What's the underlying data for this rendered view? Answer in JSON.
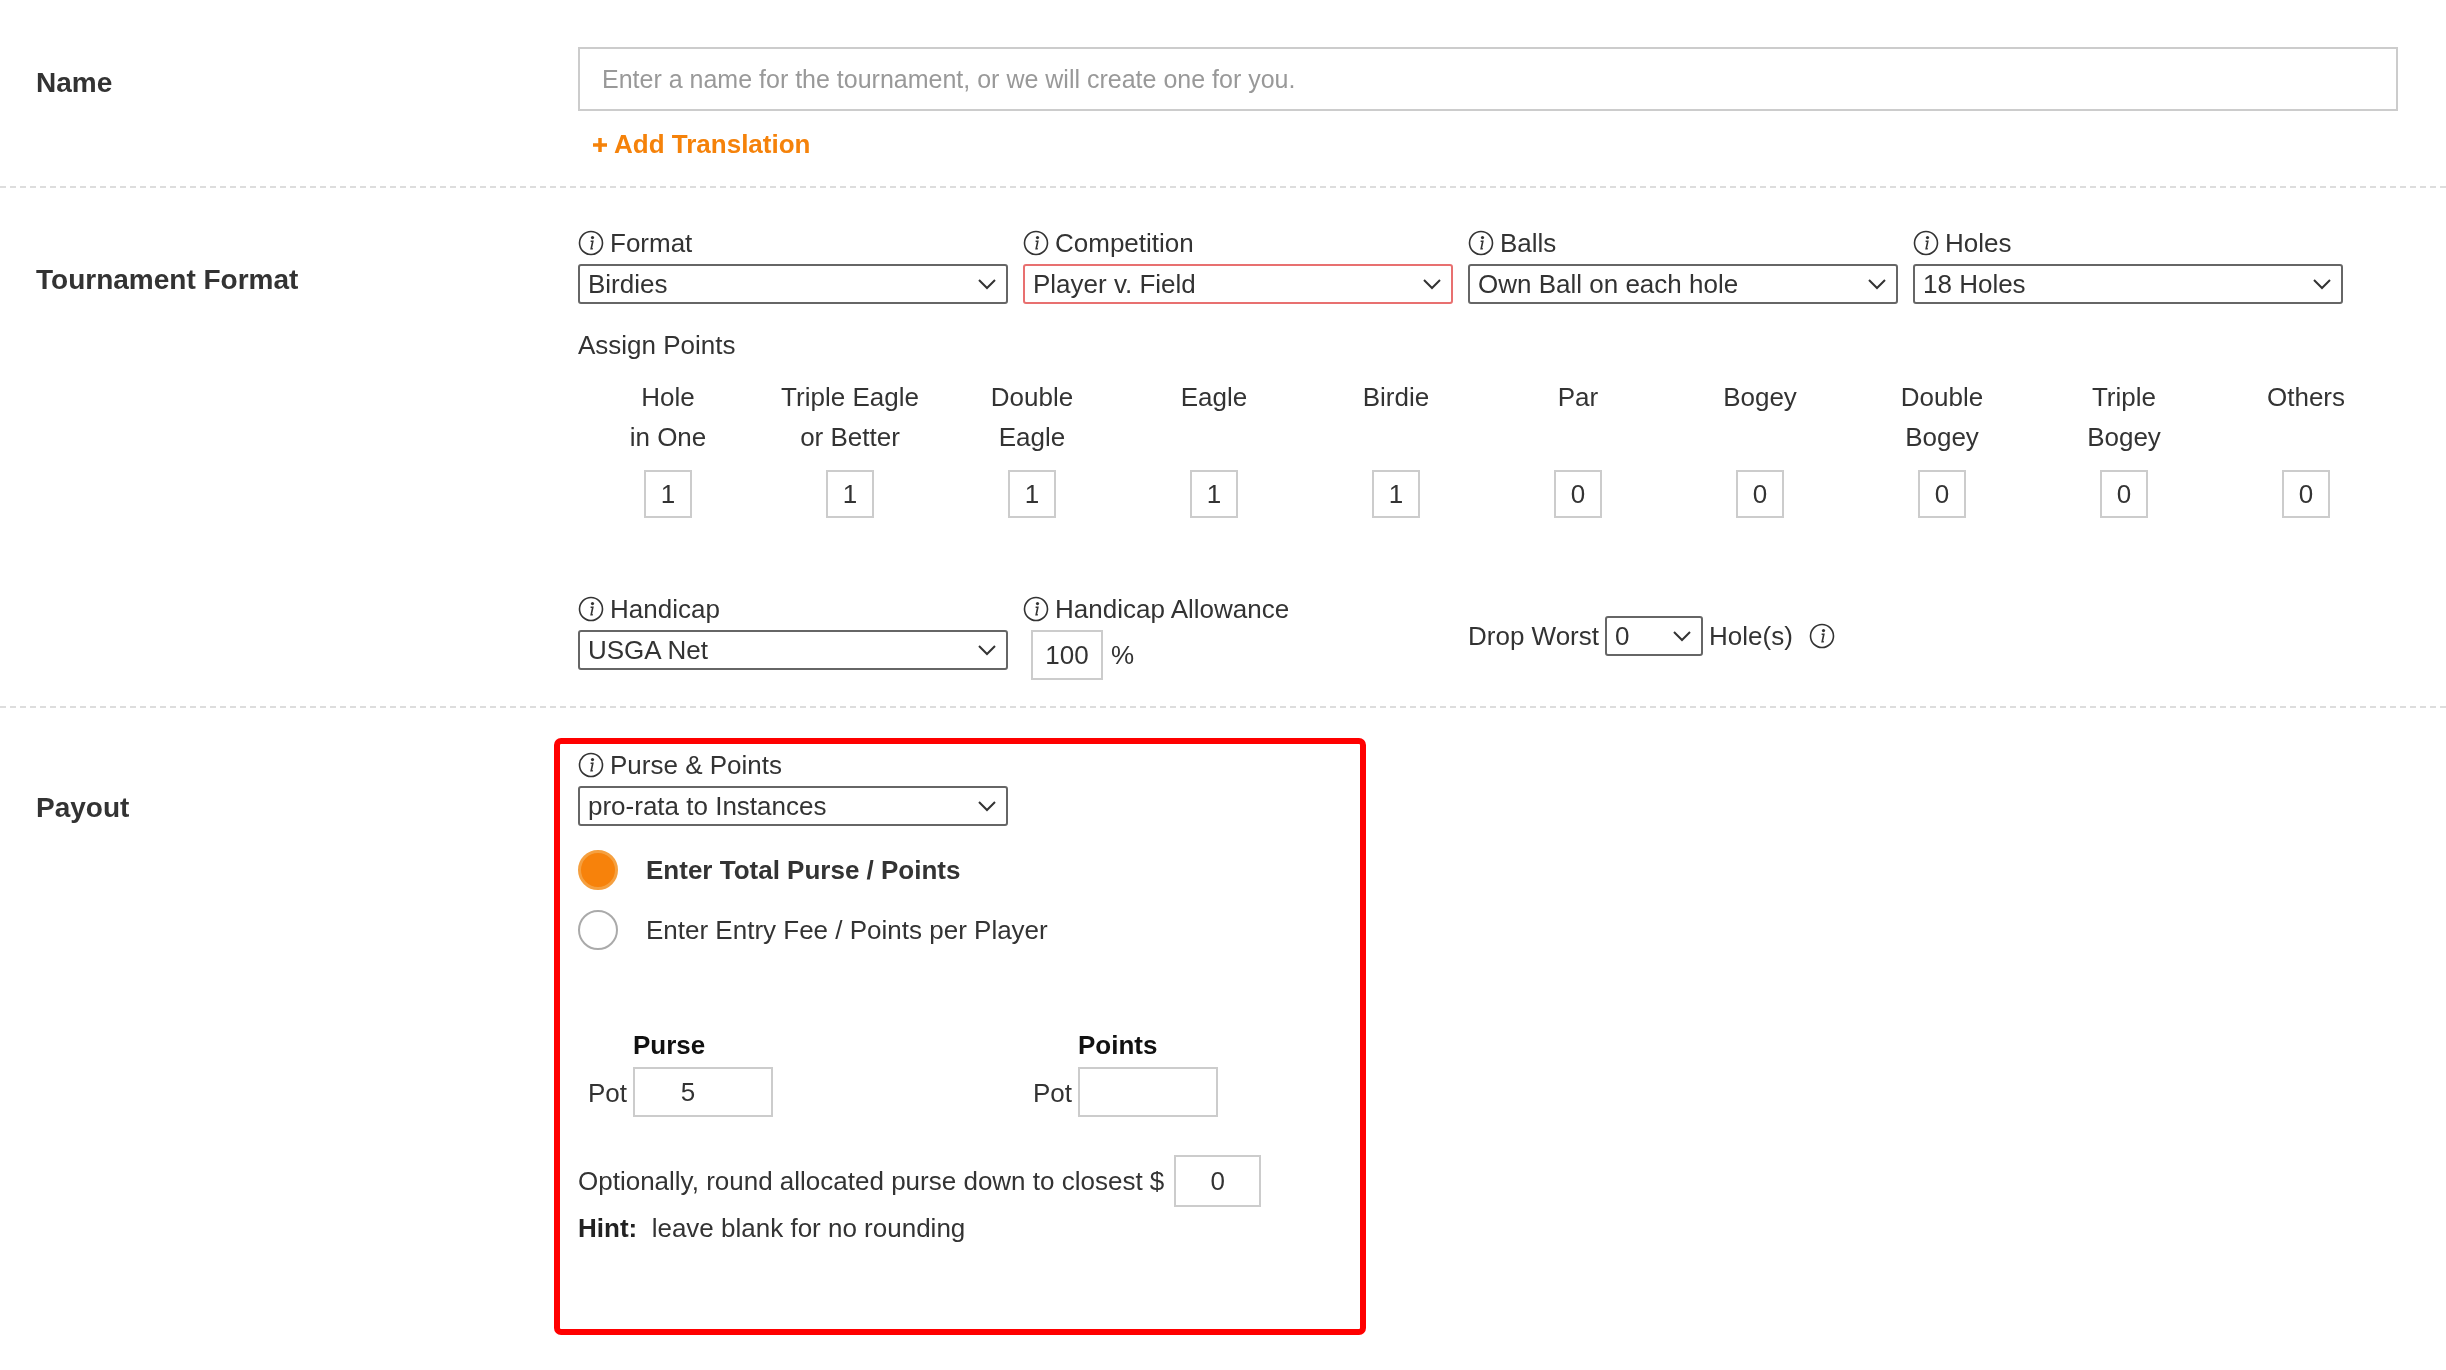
{
  "name_section": {
    "label": "Name",
    "field": {
      "placeholder": "Enter a name for the tournament, or we will create one for you."
    },
    "link": "Add Translation"
  },
  "format_section": {
    "label": "Tournament Format",
    "selects": [
      {
        "label": "Format",
        "value": "Birdies",
        "invalid": false
      },
      {
        "label": "Competition",
        "value": "Player v. Field",
        "invalid": true
      },
      {
        "label": "Balls",
        "value": "Own Ball on each hole",
        "invalid": false
      },
      {
        "label": "Holes",
        "value": "18 Holes",
        "invalid": false
      }
    ],
    "assign_points": {
      "title": "Assign Points",
      "columns": [
        {
          "header": "Hole\nin One",
          "value": "1"
        },
        {
          "header": "Triple Eagle\nor Better",
          "value": "1"
        },
        {
          "header": "Double\nEagle",
          "value": "1"
        },
        {
          "header": "Eagle",
          "value": "1"
        },
        {
          "header": "Birdie",
          "value": "1"
        },
        {
          "header": "Par",
          "value": "0"
        },
        {
          "header": "Bogey",
          "value": "0"
        },
        {
          "header": "Double\nBogey",
          "value": "0"
        },
        {
          "header": "Triple\nBogey",
          "value": "0"
        },
        {
          "header": "Others",
          "value": "0"
        }
      ]
    },
    "handicap": {
      "label": "Handicap",
      "value": "USGA Net"
    },
    "allowance": {
      "label": "Handicap Allowance",
      "value": "100",
      "unit": "%"
    },
    "drop_worst": {
      "label": "Drop Worst",
      "value": "0",
      "suffix": "Hole(s)"
    }
  },
  "payout_section": {
    "label": "Payout",
    "purse_points": {
      "label": "Purse & Points",
      "value": "pro-rata to Instances"
    },
    "options": [
      {
        "label": "Enter Total Purse / Points",
        "selected": true
      },
      {
        "label": "Enter Entry Fee / Points per Player",
        "selected": false
      }
    ],
    "pots": [
      {
        "title": "Purse",
        "label": "Pot",
        "value": "5"
      },
      {
        "title": "Points",
        "label": "Pot"
      }
    ],
    "rounding": {
      "label": "Optionally, round allocated purse down to closest $",
      "value": "0"
    },
    "hint": "**Hint:**  leave blank for no rounding"
  }
}
